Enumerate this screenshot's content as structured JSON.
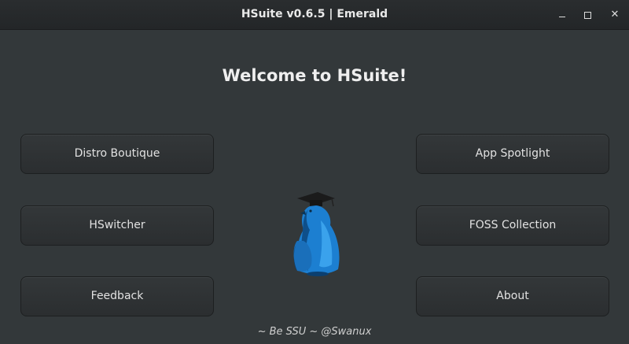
{
  "window": {
    "title": "HSuite v0.6.5 | Emerald",
    "controls": {
      "minimize_icon": "minimize-icon",
      "maximize_icon": "maximize-icon",
      "close_icon": "close-icon"
    }
  },
  "main": {
    "welcome": "Welcome to HSuite!",
    "buttons": {
      "distro_boutique": "Distro Boutique",
      "hswitcher": "HSwitcher",
      "feedback": "Feedback",
      "app_spotlight": "App Spotlight",
      "foss_collection": "FOSS Collection",
      "about": "About"
    },
    "footer": "~ Be SSU ~ @Swanux"
  },
  "colors": {
    "background": "#33383a",
    "titlebar": "#2a2d2f",
    "button": "#303436",
    "mascot_blue": "#1c7fd1"
  }
}
